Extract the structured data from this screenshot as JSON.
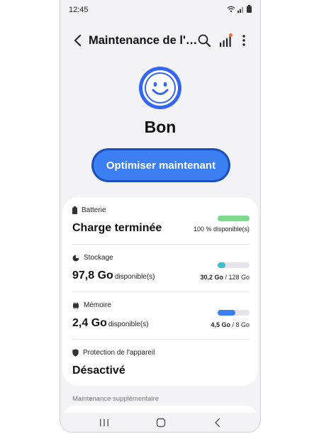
{
  "status_bar": {
    "time": "12:45"
  },
  "app_bar": {
    "title": "Maintenance de l'…"
  },
  "hero": {
    "status": "Bon"
  },
  "optimize_button": {
    "label": "Optimiser maintenant"
  },
  "items": {
    "battery": {
      "label": "Batterie",
      "value": "Charge terminée",
      "right_text": "100 % disponible(s)",
      "percent": 100,
      "color": "#7dd98b"
    },
    "storage": {
      "label": "Stockage",
      "value": "97,8 Go",
      "suffix": "disponible(s)",
      "used": "30,2 Go",
      "total": "/ 128 Go",
      "fraction": 0.236,
      "color": "#3ec0c8"
    },
    "memory": {
      "label": "Mémoire",
      "value": "2,4 Go",
      "suffix": "disponible(s)",
      "used": "4,5 Go",
      "total": "/ 8 Go",
      "fraction": 0.5625,
      "color": "#3b7ff3"
    },
    "protection": {
      "label": "Protection de l'appareil",
      "value": "Désactivé"
    }
  },
  "section": {
    "title": "Maintenance supplémentaire"
  },
  "colors": {
    "accent": "#3b7ff3",
    "smiley_blue": "#3566f0"
  },
  "icons": [
    "back-arrow-icon",
    "search-icon",
    "signal-bars-icon",
    "more-icon",
    "smiley-icon",
    "battery-icon",
    "storage-pie-icon",
    "memory-chip-icon",
    "shield-icon",
    "recents-icon",
    "home-icon",
    "nav-back-icon",
    "wifi-icon",
    "cell-signal-icon",
    "battery-status-icon"
  ]
}
